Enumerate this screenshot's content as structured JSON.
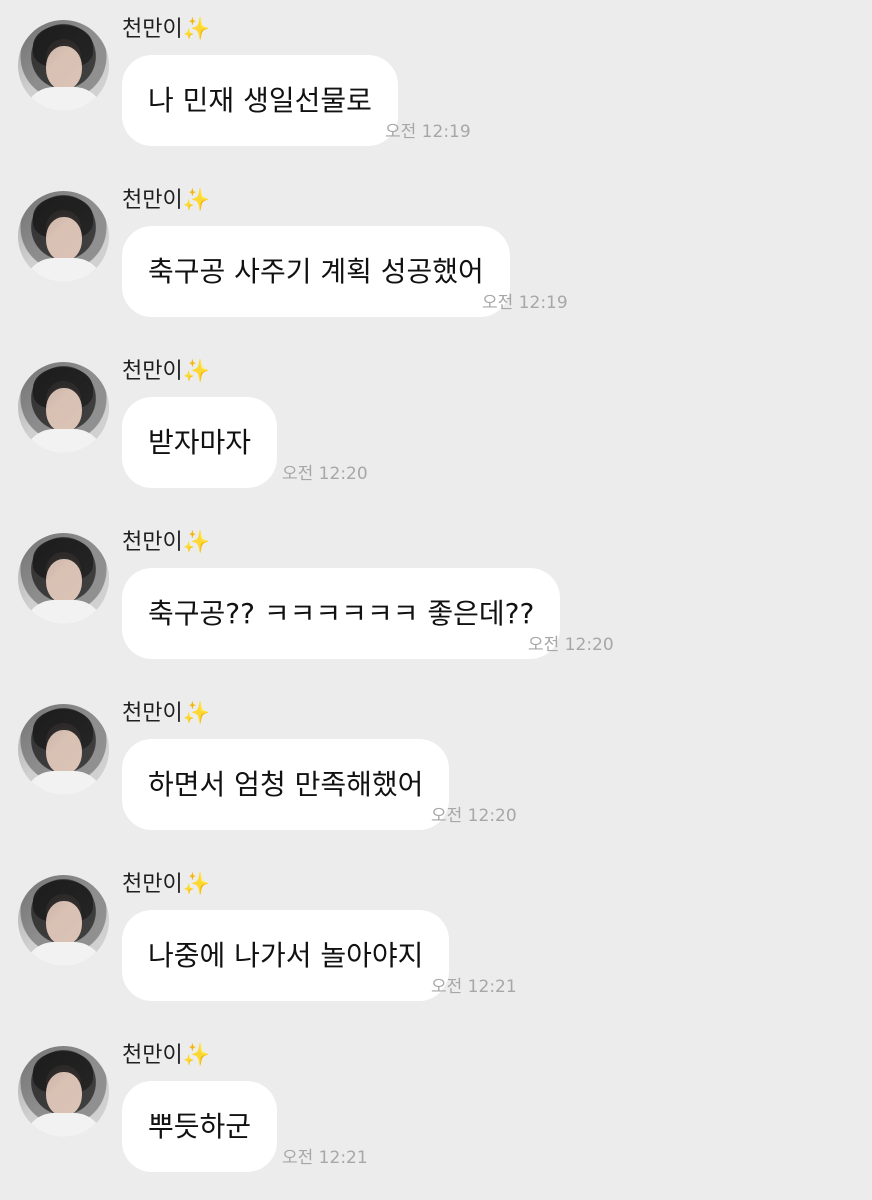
{
  "app": {
    "background_color": "#ececec"
  },
  "messages": [
    {
      "sender": "천만이✨",
      "text": "나 민재 생일선물로",
      "time": "오전 12:19"
    },
    {
      "sender": "천만이✨",
      "text": "축구공 사주기 계획 성공했어",
      "time": "오전 12:19"
    },
    {
      "sender": "천만이✨",
      "text": "받자마자",
      "time": "오전 12:20"
    },
    {
      "sender": "천만이✨",
      "text": "축구공?? ㅋㅋㅋㅋㅋㅋ 좋은데??",
      "time": "오전 12:20"
    },
    {
      "sender": "천만이✨",
      "text": "하면서 엄청 만족해했어",
      "time": "오전 12:20"
    },
    {
      "sender": "천만이✨",
      "text": "나중에 나가서 놀아야지",
      "time": "오전 12:21"
    },
    {
      "sender": "천만이✨",
      "text": "뿌듯하군",
      "time": "오전 12:21"
    }
  ],
  "icons": {
    "avatar": "profile-avatar"
  }
}
